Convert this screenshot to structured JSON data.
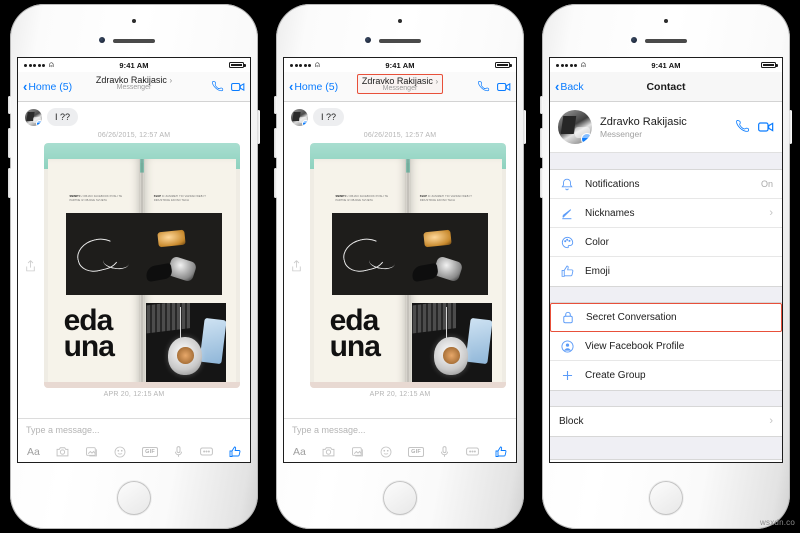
{
  "status_bar": {
    "time": "9:41 AM",
    "signal_dots": 5,
    "wifi_icon": "wifi-icon",
    "battery_icon": "battery-full-icon"
  },
  "phone1": {
    "nav": {
      "back_label": "Home (5)",
      "back_icon": "chevron-left-icon",
      "contact_name": "Zdravko Rakijasic",
      "name_arrow": "›",
      "contact_sub": "Messenger",
      "call_icon": "phone-call-icon",
      "video_icon": "video-camera-icon",
      "highlighted": false
    },
    "chat": {
      "message_text": "I ??",
      "avatar_icon": "contact-avatar",
      "badge_icon": "messenger-badge-icon",
      "timestamp_top": "06/26/2015, 12:57 AM",
      "timestamp_bottom": "APR 20, 12:15 AM",
      "share_icon": "share-upload-icon",
      "photo_alt": "magazine-spread-photo",
      "photo_text_left": "eda",
      "photo_text_left2": "una",
      "photo_caption_left_bold": "SNIMITI",
      "photo_caption_left": "U OBJAVI FACEBOOK POSLI TE PARTNE IZ OBJAVE SVIJETA",
      "photo_caption_right_bold": "SVAP",
      "photo_caption_right": "IC ZANIMETI TIO VAZDAN WEB IT INDUSTRIJE ZAVISO TECH"
    },
    "composer": {
      "placeholder": "Type a message...",
      "tools": [
        {
          "name": "text-format-button",
          "label": "Aa",
          "icon": "text-format-icon"
        },
        {
          "name": "camera-button",
          "label": "",
          "icon": "camera-icon"
        },
        {
          "name": "photo-library-button",
          "label": "",
          "icon": "photo-library-icon"
        },
        {
          "name": "emoji-button",
          "label": "",
          "icon": "smiley-icon"
        },
        {
          "name": "gif-button",
          "label": "GIF",
          "icon": "gif-icon"
        },
        {
          "name": "voice-record-button",
          "label": "",
          "icon": "microphone-icon"
        },
        {
          "name": "stickers-button",
          "label": "",
          "icon": "stickers-icon"
        },
        {
          "name": "thumbs-up-button",
          "label": "",
          "icon": "thumbs-up-icon"
        }
      ]
    }
  },
  "phone2": {
    "nav": {
      "back_label": "Home (5)",
      "contact_name": "Zdravko Rakijasic",
      "contact_sub": "Messenger",
      "highlighted": true
    }
  },
  "phone3": {
    "nav": {
      "back_label": "Back",
      "back_icon": "chevron-left-icon",
      "title": "Contact"
    },
    "header": {
      "name": "Zdravko Rakijasic",
      "sub": "Messenger",
      "call_icon": "phone-call-icon",
      "video_icon": "video-camera-icon",
      "avatar_icon": "contact-avatar",
      "badge_icon": "messenger-badge-icon"
    },
    "menu_group_1": [
      {
        "label": "Notifications",
        "icon": "bell-icon",
        "value": "On",
        "chevron": false,
        "highlight": false
      },
      {
        "label": "Nicknames",
        "icon": "pencil-icon",
        "value": "",
        "chevron": true,
        "highlight": false
      },
      {
        "label": "Color",
        "icon": "palette-icon",
        "value": "",
        "chevron": false,
        "highlight": false
      },
      {
        "label": "Emoji",
        "icon": "thumbs-up-icon",
        "value": "",
        "chevron": false,
        "highlight": false
      }
    ],
    "menu_group_2": [
      {
        "label": "Secret Conversation",
        "icon": "lock-icon",
        "value": "",
        "chevron": false,
        "highlight": true
      },
      {
        "label": "View Facebook Profile",
        "icon": "person-circle-icon",
        "value": "",
        "chevron": false,
        "highlight": false
      },
      {
        "label": "Create Group",
        "icon": "plus-icon",
        "value": "",
        "chevron": false,
        "highlight": false
      }
    ],
    "menu_group_3": [
      {
        "label": "Block",
        "icon": "",
        "value": "",
        "chevron": true,
        "highlight": false
      }
    ]
  },
  "watermark": {
    "text": "wsxdn.co"
  },
  "colors": {
    "accent_blue": "#0a7cff",
    "highlight_red": "#e8503a",
    "icon_blue": "#5b9bf8",
    "bubble_gray": "#edeef0"
  }
}
